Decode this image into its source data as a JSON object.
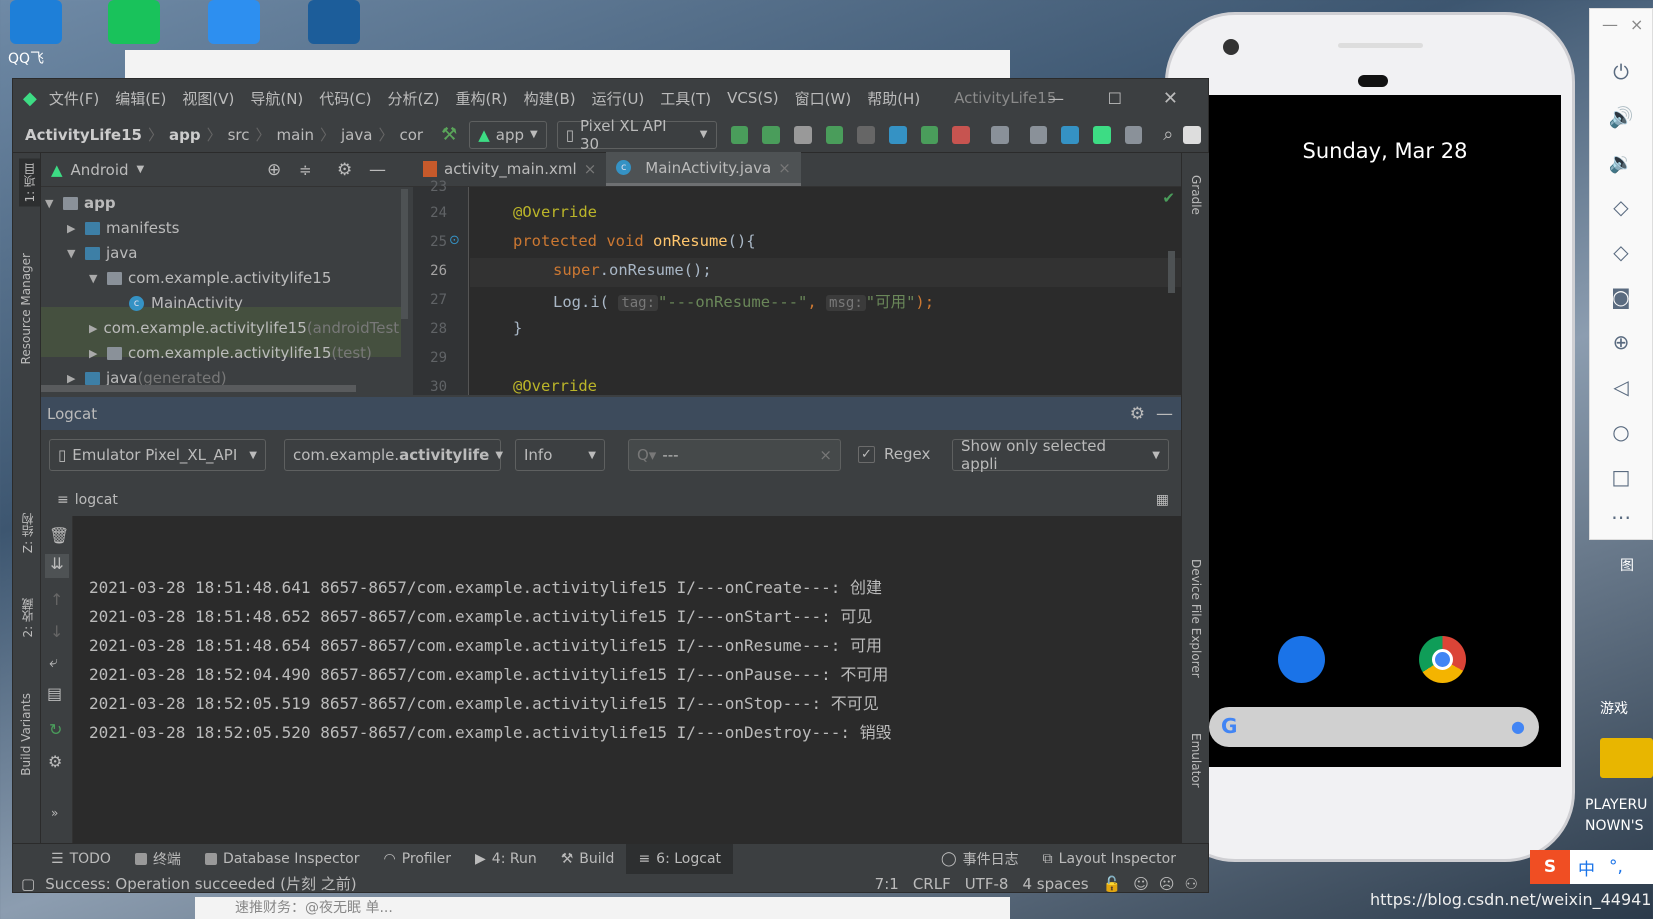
{
  "desktop": {
    "icons": [
      {
        "label": "QQ飞",
        "color": "#1e7fd8"
      },
      {
        "label": "",
        "color": "#19c25b"
      },
      {
        "label": "",
        "color": "#2d8ff0"
      },
      {
        "label": "",
        "color": "#1c5d9a"
      }
    ],
    "right_labels": [
      "游戏",
      "PLAYERU",
      "NOWN'S",
      "图"
    ],
    "watermark": "https://blog.csdn.net/weixin_44941105",
    "taskbar_text": "速推财务：@夜无眠 单...",
    "ime": [
      "中",
      "°,"
    ]
  },
  "ide": {
    "menu": [
      "文件(F)",
      "编辑(E)",
      "视图(V)",
      "导航(N)",
      "代码(C)",
      "分析(Z)",
      "重构(R)",
      "构建(B)",
      "运行(U)",
      "工具(T)",
      "VCS(S)",
      "窗口(W)",
      "帮助(H)"
    ],
    "window_title": "ActivityLife15",
    "breadcrumb": [
      "ActivityLife15",
      "app",
      "src",
      "main",
      "java",
      "cor"
    ],
    "run_config": "app",
    "device": "Pixel XL API 30",
    "left_stripe": [
      "1: 项目",
      "Resource Manager",
      "Z: 结构",
      "2: 收藏",
      "Build Variants"
    ],
    "right_stripe": [
      "Gradle",
      "Device File Explorer",
      "Emulator"
    ],
    "project": {
      "view": "Android",
      "tree": [
        {
          "label": "app",
          "indent": 0,
          "open": true,
          "type": "module"
        },
        {
          "label": "manifests",
          "indent": 1,
          "open": false,
          "type": "folder"
        },
        {
          "label": "java",
          "indent": 1,
          "open": true,
          "type": "folder"
        },
        {
          "label": "com.example.activitylife15",
          "indent": 2,
          "open": true,
          "type": "package"
        },
        {
          "label": "MainActivity",
          "indent": 3,
          "type": "class"
        },
        {
          "label": "com.example.activitylife15",
          "suffix": " (androidTest)",
          "indent": 2,
          "open": false,
          "type": "package"
        },
        {
          "label": "com.example.activitylife15",
          "suffix": " (test)",
          "indent": 2,
          "open": false,
          "type": "package"
        },
        {
          "label": "java",
          "suffix": " (generated)",
          "indent": 1,
          "open": false,
          "type": "folder"
        }
      ]
    },
    "tabs": [
      {
        "label": "activity_main.xml",
        "active": false
      },
      {
        "label": "MainActivity.java",
        "active": true
      }
    ],
    "code": {
      "line_numbers": [
        "23",
        "24",
        "25",
        "26",
        "27",
        "28",
        "29",
        "30"
      ],
      "l24": "@Override",
      "l25_kw": "protected void ",
      "l25_fn": "onResume",
      "l25_rest": "(){",
      "l26_kw": "super",
      "l26_rest": ".onResume();",
      "l27_a": "Log.i( ",
      "l27_tag": "tag:",
      "l27_s1": "\"---onResume---\"",
      "l27_c": ", ",
      "l27_msg": "msg:",
      "l27_s2": "\"可用\"",
      "l27_end": ");",
      "l28": "}",
      "l30": "@Override"
    },
    "logcat": {
      "title": "Logcat",
      "device": "Emulator Pixel_XL_API",
      "package_plain": "com.example.",
      "package_bold": "activitylife",
      "level": "Info",
      "search": "---",
      "regex_label": "Regex",
      "regex_checked": true,
      "filter": "Show only selected appli",
      "tab": "logcat",
      "lines": [
        "2021-03-28 18:51:48.641 8657-8657/com.example.activitylife15 I/---onCreate---: 创建",
        "2021-03-28 18:51:48.652 8657-8657/com.example.activitylife15 I/---onStart---: 可见",
        "2021-03-28 18:51:48.654 8657-8657/com.example.activitylife15 I/---onResume---: 可用",
        "2021-03-28 18:52:04.490 8657-8657/com.example.activitylife15 I/---onPause---: 不可用",
        "2021-03-28 18:52:05.519 8657-8657/com.example.activitylife15 I/---onStop---: 不可见",
        "2021-03-28 18:52:05.520 8657-8657/com.example.activitylife15 I/---onDestroy---: 销毁"
      ]
    },
    "bottom_tools": [
      "TODO",
      "终端",
      "Database Inspector",
      "Profiler",
      "4: Run",
      "Build",
      "6: Logcat"
    ],
    "bottom_right": [
      "事件日志",
      "Layout Inspector"
    ],
    "status": {
      "message": "Success: Operation succeeded (片刻 之前)",
      "position": "7:1",
      "line_sep": "CRLF",
      "encoding": "UTF-8",
      "indent": "4 spaces"
    }
  },
  "phone": {
    "date": "Sunday, Mar 28"
  },
  "emulator_controls": [
    "power",
    "volume-up",
    "volume-down",
    "rotate-left",
    "rotate-right",
    "screenshot",
    "zoom",
    "back",
    "home",
    "overview",
    "more"
  ],
  "colors": {
    "android_green": "#3ddc84",
    "keyword": "#cc7832",
    "string": "#6a8759",
    "annotation": "#bbb529"
  }
}
